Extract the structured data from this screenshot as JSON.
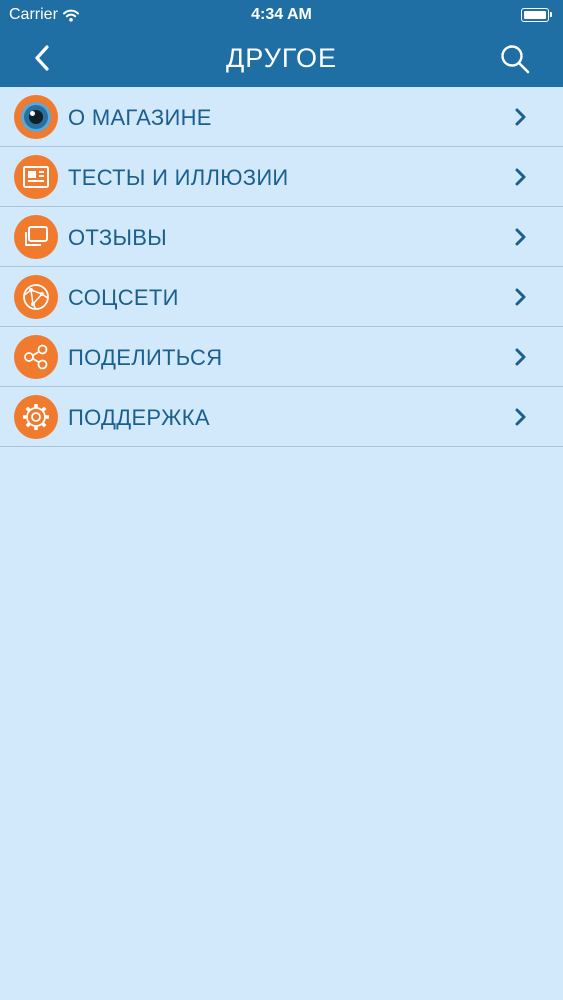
{
  "status_bar": {
    "carrier": "Carrier",
    "time": "4:34 AM"
  },
  "nav": {
    "title": "ДРУГОЕ"
  },
  "colors": {
    "header": "#1f6fa4",
    "background": "#d2e9fb",
    "icon_circle": "#f07a2d",
    "label": "#1b5f8f"
  },
  "menu": {
    "items": [
      {
        "label": "О МАГАЗИНЕ",
        "icon": "eye-icon"
      },
      {
        "label": "ТЕСТЫ И ИЛЛЮЗИИ",
        "icon": "newspaper-icon"
      },
      {
        "label": "ОТЗЫВЫ",
        "icon": "chat-icon"
      },
      {
        "label": "СОЦСЕТИ",
        "icon": "network-icon"
      },
      {
        "label": "ПОДЕЛИТЬСЯ",
        "icon": "share-icon"
      },
      {
        "label": "ПОДДЕРЖКА",
        "icon": "gear-icon"
      }
    ]
  }
}
